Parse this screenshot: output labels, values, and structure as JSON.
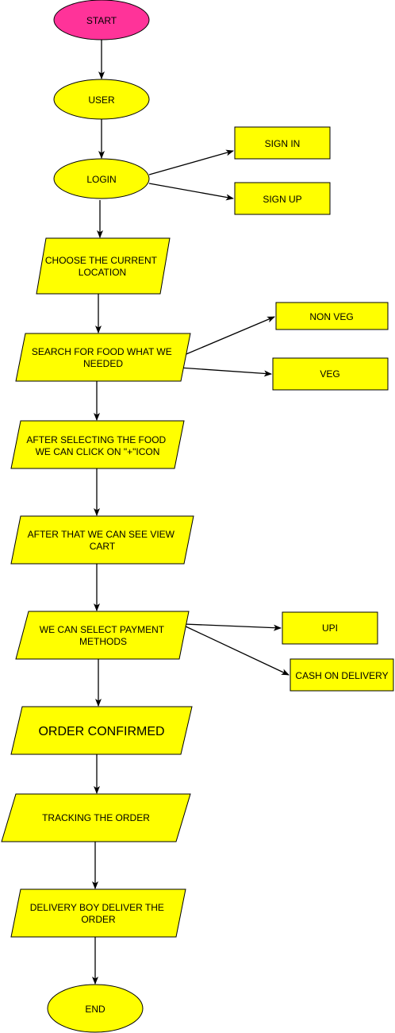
{
  "colors": {
    "start_fill": "#ff3399",
    "shape_fill": "#ffff00",
    "stroke": "#000000",
    "connector": "#000000",
    "background": "#ffffff"
  },
  "nodes": {
    "start": {
      "label": "START"
    },
    "user": {
      "label": "USER"
    },
    "login": {
      "label": "LOGIN"
    },
    "sign_in": {
      "label": "SIGN IN"
    },
    "sign_up": {
      "label": "SIGN UP"
    },
    "choose_location": {
      "lines": [
        "CHOOSE THE CURRENT",
        "LOCATION"
      ]
    },
    "search_food": {
      "lines": [
        "SEARCH FOR FOOD WHAT WE",
        "NEEDED"
      ]
    },
    "non_veg": {
      "label": "NON VEG"
    },
    "veg": {
      "label": "VEG"
    },
    "select_food": {
      "lines": [
        "AFTER SELECTING THE FOOD",
        "WE CAN CLICK ON \"+\"ICON"
      ]
    },
    "view_cart": {
      "lines": [
        "AFTER THAT WE CAN SEE VIEW",
        "CART"
      ]
    },
    "payment": {
      "lines": [
        "WE CAN SELECT PAYMENT",
        "METHODS"
      ]
    },
    "upi": {
      "label": "UPI"
    },
    "cod": {
      "label": "CASH ON DELIVERY"
    },
    "order_confirmed": {
      "label": "ORDER CONFIRMED"
    },
    "tracking": {
      "label": "TRACKING THE ORDER"
    },
    "delivery": {
      "lines": [
        "DELIVERY BOY  DELIVER THE",
        "ORDER"
      ]
    },
    "end": {
      "label": "END"
    }
  }
}
